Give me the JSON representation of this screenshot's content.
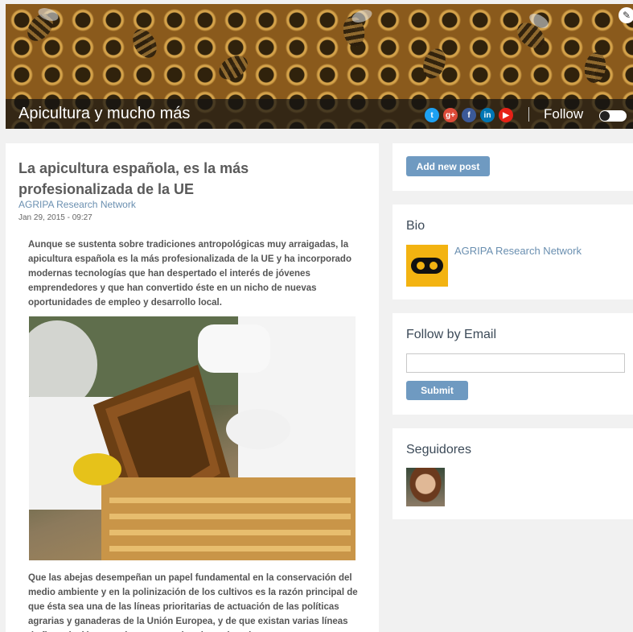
{
  "header": {
    "blog_title": "Apicultura y mucho más",
    "follow_label": "Follow",
    "social_icons": [
      "twitter-icon",
      "google-plus-icon",
      "facebook-icon",
      "linkedin-icon",
      "youtube-icon"
    ],
    "social_glyphs": [
      "t",
      "g+",
      "f",
      "in",
      "▶"
    ],
    "social_colors": [
      "#1da1f2",
      "#dd4b39",
      "#3b5998",
      "#0077b5",
      "#e62117"
    ]
  },
  "post": {
    "title": "La apicultura española, es la más profesionalizada de la UE",
    "author": "AGRIPA Research Network",
    "date": "Jan 29, 2015 - 09:27",
    "lead": "Aunque se sustenta sobre tradiciones antropológicas muy arraigadas, la apicultura española es la más profesionalizada de la UE y ha incorporado modernas tecnologías que han despertado el interés de jóvenes emprendedores y que han convertido éste en un nicho de nuevas oportunidades de empleo y desarrollo local.",
    "body": "Que las abejas desempeñan un papel fundamental en la conservación del medio ambiente y en la polinización de los cultivos es la razón principal de que ésta sea una de las líneas prioritarias de actuación de las políticas agrarias y ganaderas de la Unión Europea, y de que existan varias líneas de financiación y ayuda para este tipo de explotaciones"
  },
  "sidebar": {
    "add_post_label": "Add new post",
    "bio_title": "Bio",
    "bio_name": "AGRIPA Research Network",
    "follow_email_title": "Follow by Email",
    "submit_label": "Submit",
    "followers_title": "Seguidores"
  },
  "colors": {
    "link": "#6a8fb0",
    "button": "#6f9ac1",
    "bio_avatar": "#f3b311"
  }
}
